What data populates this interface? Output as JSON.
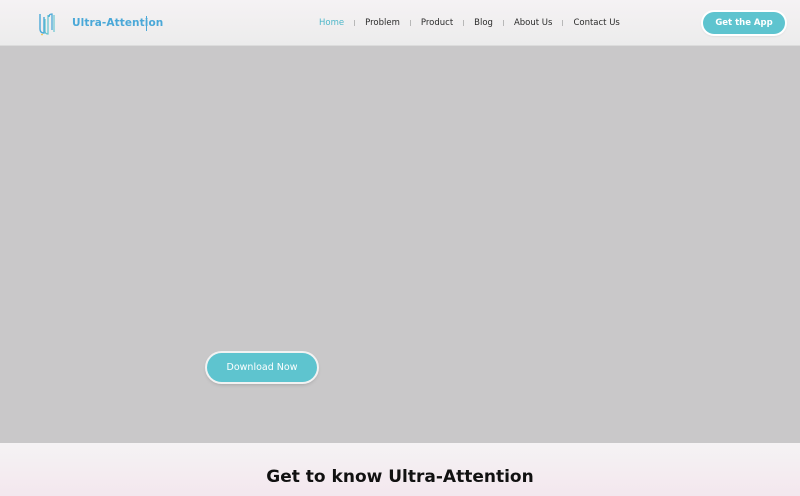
{
  "brand": {
    "name": "Ultra-Attention"
  },
  "nav": {
    "items": [
      {
        "label": "Home"
      },
      {
        "label": "Problem"
      },
      {
        "label": "Product"
      },
      {
        "label": "Blog"
      },
      {
        "label": "About Us"
      },
      {
        "label": "Contact Us"
      }
    ],
    "active_index": 0
  },
  "header": {
    "cta_label": "Get the App"
  },
  "hero": {
    "download_label": "Download Now"
  },
  "about": {
    "title": "Get to know Ultra-Attention"
  },
  "colors": {
    "accent": "#5ec4cf",
    "brand_text": "#4aa8d8",
    "hero_bg": "#c9c8c9"
  },
  "icons": {
    "logo": "ultra-attention-logo-icon"
  }
}
